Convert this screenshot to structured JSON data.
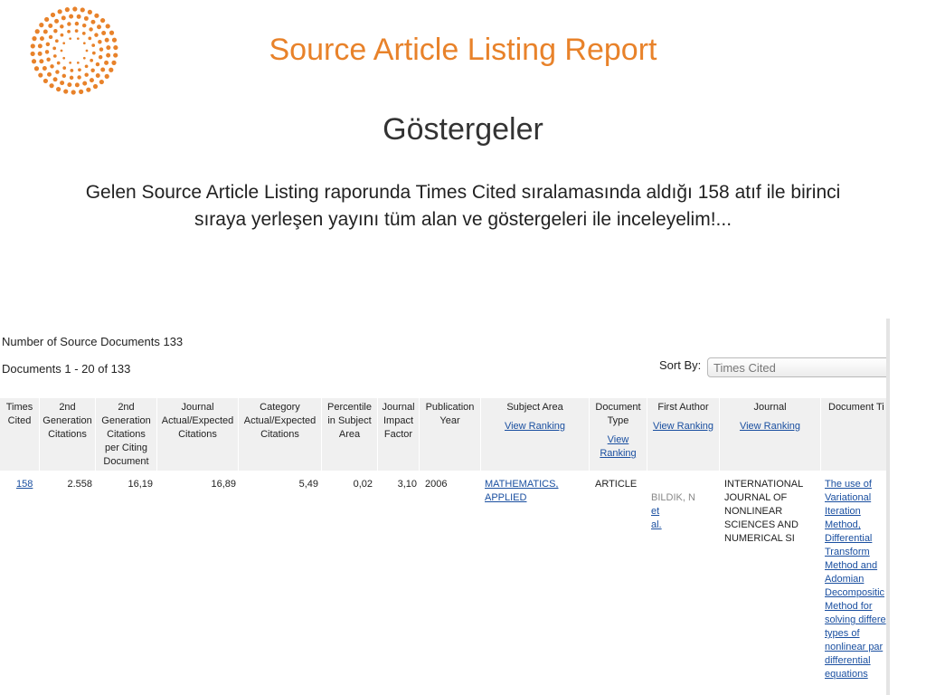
{
  "slide": {
    "title": "Source Article Listing Report",
    "subtitle": "Göstergeler",
    "intro": "Gelen Source Article Listing raporunda Times Cited sıralamasında aldığı 158 atıf ile birinci\nsıraya yerleşen yayını tüm alan ve göstergeleri ile inceleyelim!..."
  },
  "colors": {
    "accent": "#e8822a",
    "link": "#1a4fa0",
    "header_bg": "#f0f0f0"
  },
  "report": {
    "num_source_docs": "Number of Source Documents 133",
    "docs_range": "Documents 1 - 20  of  133",
    "sort_by_label": "Sort By:",
    "sort_by_value": "Times Cited",
    "columns": [
      {
        "label": "Times\nCited",
        "link": ""
      },
      {
        "label": "2nd\nGeneration\nCitations",
        "link": ""
      },
      {
        "label": "2nd\nGeneration\nCitations\nper Citing\nDocument",
        "link": ""
      },
      {
        "label": "Journal\nActual/Expected\nCitations",
        "link": ""
      },
      {
        "label": "Category\nActual/Expected\nCitations",
        "link": ""
      },
      {
        "label": "Percentile\nin Subject\nArea",
        "link": ""
      },
      {
        "label": "Journal\nImpact\nFactor",
        "link": ""
      },
      {
        "label": "Publication\nYear",
        "link": ""
      },
      {
        "label": "Subject Area",
        "link": "View Ranking"
      },
      {
        "label": "Document\nType",
        "link": "View\nRanking"
      },
      {
        "label": "First Author",
        "link": "View Ranking"
      },
      {
        "label": "Journal",
        "link": "View Ranking"
      },
      {
        "label": "Document Ti",
        "link": ""
      }
    ],
    "row": {
      "times_cited": "158",
      "gen2_citations": "2.558",
      "gen2_per_doc": "16,19",
      "journal_ae": "16,89",
      "category_ae": "5,49",
      "percentile": "0,02",
      "impact_factor": "3,10",
      "pub_year": "2006",
      "subject_area": "MATHEMATICS,\nAPPLIED",
      "doc_type": "ARTICLE",
      "first_author": "BILDIK, N",
      "et_al": "et\nal.",
      "journal": "INTERNATIONAL\nJOURNAL OF\nNONLINEAR\nSCIENCES AND\nNUMERICAL SI",
      "doc_title": "The use of\nVariational\nIteration\nMethod,\nDifferential\nTransform\nMethod and\nAdomian\nDecompositic\nMethod for\nsolving differe\ntypes of\nnonlinear par\ndifferential\nequations"
    }
  }
}
